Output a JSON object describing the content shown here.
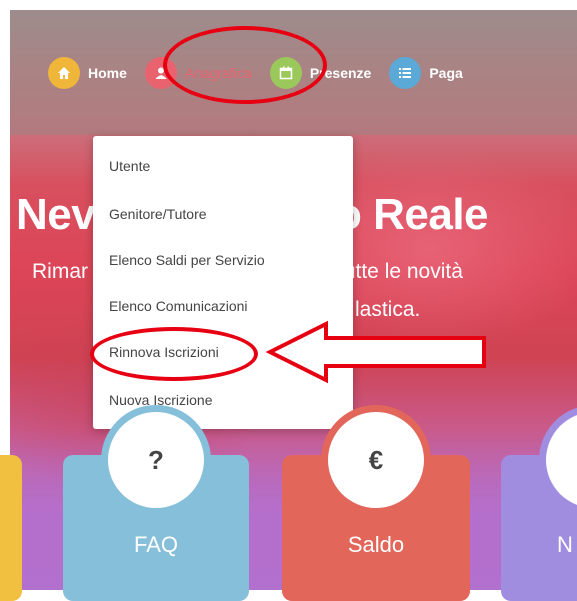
{
  "nav": {
    "items": [
      {
        "label": "Home",
        "icon": "home-icon",
        "color": "#f0b63a"
      },
      {
        "label": "Anagrafica",
        "icon": "user-icon",
        "color": "#e8636e"
      },
      {
        "label": "Presenze",
        "icon": "calendar-icon",
        "color": "#9ac85a"
      },
      {
        "label": "Paga",
        "icon": "list-icon",
        "color": "#5aa9d6"
      }
    ]
  },
  "hero": {
    "title_left": "Nev",
    "title_right": "o Reale",
    "sub1_left": "Rimar",
    "sub1_right": "tutte le novità",
    "sub2": "lastica."
  },
  "dropdown": {
    "items": [
      "Utente",
      "Genitore/Tutore",
      "Elenco Saldi per Servizio",
      "Elenco Comunicazioni",
      "Rinnova Iscrizioni",
      "Nuova Iscrizione"
    ]
  },
  "cards": [
    {
      "label": "",
      "icon": "",
      "color": "#f2c040"
    },
    {
      "label": "FAQ",
      "icon": "?",
      "color": "#86bfd9"
    },
    {
      "label": "Saldo",
      "icon": "€",
      "color": "#e2665a"
    },
    {
      "label": "N",
      "icon": "",
      "color": "#a08de0"
    }
  ],
  "annotations": {
    "ring_color": "#e60012",
    "arrow_fill": "#ffffff",
    "arrow_stroke": "#e60012"
  }
}
